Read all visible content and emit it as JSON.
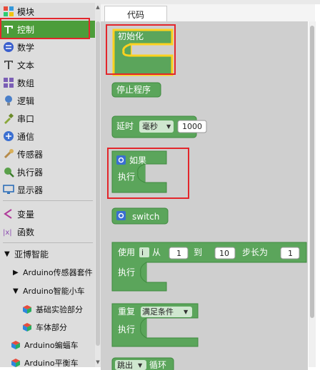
{
  "sidebar": {
    "items": [
      {
        "label": "模块",
        "icon": "puzzle-icon"
      },
      {
        "label": "控制",
        "icon": "control-icon"
      },
      {
        "label": "数学",
        "icon": "math-icon"
      },
      {
        "label": "文本",
        "icon": "text-icon"
      },
      {
        "label": "数组",
        "icon": "array-icon"
      },
      {
        "label": "逻辑",
        "icon": "bulb-icon"
      },
      {
        "label": "串口",
        "icon": "serial-icon"
      },
      {
        "label": "通信",
        "icon": "communication-icon"
      },
      {
        "label": "传感器",
        "icon": "sensor-icon"
      },
      {
        "label": "执行器",
        "icon": "actuator-icon"
      },
      {
        "label": "显示器",
        "icon": "display-icon"
      },
      {
        "label": "变量",
        "icon": "variable-icon"
      },
      {
        "label": "函数",
        "icon": "function-icon"
      }
    ],
    "tree": [
      {
        "label": "亚博智能"
      },
      {
        "label": "Arduino传感器套件"
      },
      {
        "label": "Arduino智能小车"
      },
      {
        "label": "基础实验部分"
      },
      {
        "label": "车体部分"
      },
      {
        "label": "Arduino蝙蝠车"
      },
      {
        "label": "Arduino平衡车"
      }
    ]
  },
  "tab": {
    "label": "代码"
  },
  "blocks": {
    "init": "初始化",
    "stop": "停止程序",
    "delay": {
      "label": "延时",
      "unit": "毫秒",
      "value": "1000"
    },
    "if": {
      "label": "如果",
      "do": "执行"
    },
    "switch": {
      "label": "switch"
    },
    "for": {
      "use": "使用",
      "var": "i",
      "from": "从",
      "from_val": "1",
      "to": "到",
      "to_val": "10",
      "step": "步长为",
      "step_val": "1",
      "do": "执行"
    },
    "repeat": {
      "label": "重复",
      "cond": "满足条件",
      "do": "执行"
    },
    "break": {
      "label": "跳出",
      "loop": "循环"
    }
  },
  "colors": {
    "block": "#5ba55b",
    "block_border": "#3f8a3f",
    "selected": "#4c9d3a",
    "highlight": "#ffd21f",
    "annotation": "#e3262b"
  }
}
